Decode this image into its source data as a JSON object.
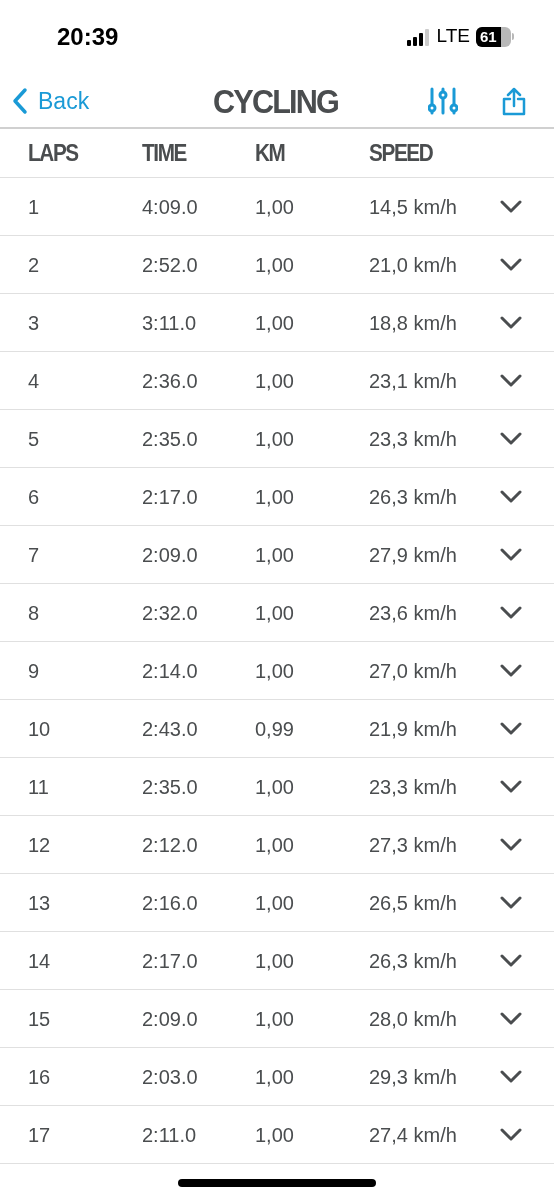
{
  "status_bar": {
    "time": "20:39",
    "network": "LTE",
    "battery": "61"
  },
  "nav": {
    "back": "Back",
    "title": "CYCLING"
  },
  "table": {
    "columns": [
      "LAPS",
      "TIME",
      "KM",
      "SPEED"
    ],
    "rows": [
      [
        "1",
        "4:09.0",
        "1,00",
        "14,5 km/h"
      ],
      [
        "2",
        "2:52.0",
        "1,00",
        "21,0 km/h"
      ],
      [
        "3",
        "3:11.0",
        "1,00",
        "18,8 km/h"
      ],
      [
        "4",
        "2:36.0",
        "1,00",
        "23,1 km/h"
      ],
      [
        "5",
        "2:35.0",
        "1,00",
        "23,3 km/h"
      ],
      [
        "6",
        "2:17.0",
        "1,00",
        "26,3 km/h"
      ],
      [
        "7",
        "2:09.0",
        "1,00",
        "27,9 km/h"
      ],
      [
        "8",
        "2:32.0",
        "1,00",
        "23,6 km/h"
      ],
      [
        "9",
        "2:14.0",
        "1,00",
        "27,0 km/h"
      ],
      [
        "10",
        "2:43.0",
        "0,99",
        "21,9 km/h"
      ],
      [
        "11",
        "2:35.0",
        "1,00",
        "23,3 km/h"
      ],
      [
        "12",
        "2:12.0",
        "1,00",
        "27,3 km/h"
      ],
      [
        "13",
        "2:16.0",
        "1,00",
        "26,5 km/h"
      ],
      [
        "14",
        "2:17.0",
        "1,00",
        "26,3 km/h"
      ],
      [
        "15",
        "2:09.0",
        "1,00",
        "28,0 km/h"
      ],
      [
        "16",
        "2:03.0",
        "1,00",
        "29,3 km/h"
      ],
      [
        "17",
        "2:11.0",
        "1,00",
        "27,4 km/h"
      ]
    ]
  }
}
